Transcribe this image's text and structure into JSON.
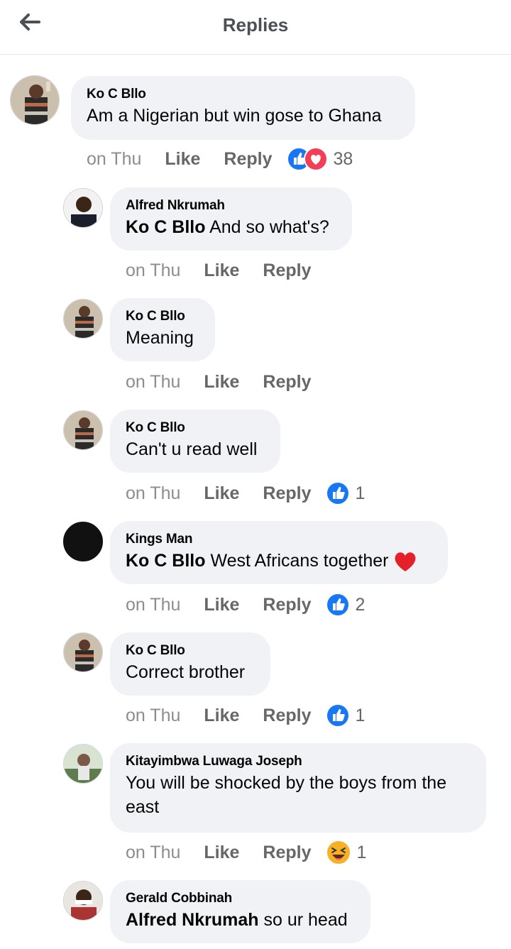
{
  "header": {
    "title": "Replies"
  },
  "comments": [
    {
      "author": "Ko C Bllo",
      "mention": "",
      "text": "Am a Nigerian but win gose to Ghana",
      "time": "on Thu",
      "like": "Like",
      "reply": "Reply",
      "reaction_count": "38",
      "reactions": [
        "like",
        "love"
      ]
    },
    {
      "author": "Alfred Nkrumah",
      "mention": "Ko C Bllo",
      "text": " And so what's?",
      "time": "on Thu",
      "like": "Like",
      "reply": "Reply",
      "reaction_count": "",
      "reactions": []
    },
    {
      "author": "Ko C Bllo",
      "mention": "",
      "text": "Meaning",
      "time": "on Thu",
      "like": "Like",
      "reply": "Reply",
      "reaction_count": "",
      "reactions": []
    },
    {
      "author": "Ko C Bllo",
      "mention": "",
      "text": "Can't u read well",
      "time": "on Thu",
      "like": "Like",
      "reply": "Reply",
      "reaction_count": "1",
      "reactions": [
        "like"
      ]
    },
    {
      "author": "Kings Man",
      "mention": "Ko C Bllo",
      "text": " West Africans together",
      "time": "on Thu",
      "like": "Like",
      "reply": "Reply",
      "reaction_count": "2",
      "reactions": [
        "like"
      ]
    },
    {
      "author": "Ko C Bllo",
      "mention": "",
      "text": "Correct brother",
      "time": "on Thu",
      "like": "Like",
      "reply": "Reply",
      "reaction_count": "1",
      "reactions": [
        "like"
      ]
    },
    {
      "author": "Kitayimbwa Luwaga Joseph",
      "mention": "",
      "text": "You will be shocked by the boys from the east",
      "time": "on Thu",
      "like": "Like",
      "reply": "Reply",
      "reaction_count": "1",
      "reactions": [
        "haha"
      ]
    },
    {
      "author": "Gerald Cobbinah",
      "mention": "Alfred Nkrumah",
      "text": " so ur head",
      "time": "",
      "like": "",
      "reply": "",
      "reaction_count": "",
      "reactions": []
    }
  ],
  "colors": {
    "like_blue": "#1877f2",
    "love_red": "#f33e58",
    "haha_yellow": "#f7b125",
    "bubble_bg": "#f0f2f5",
    "meta_gray": "#65676b"
  },
  "icons": {
    "back": "arrow-left-icon",
    "like": "thumbs-up-icon",
    "love": "heart-icon",
    "haha": "laughing-face-icon"
  }
}
